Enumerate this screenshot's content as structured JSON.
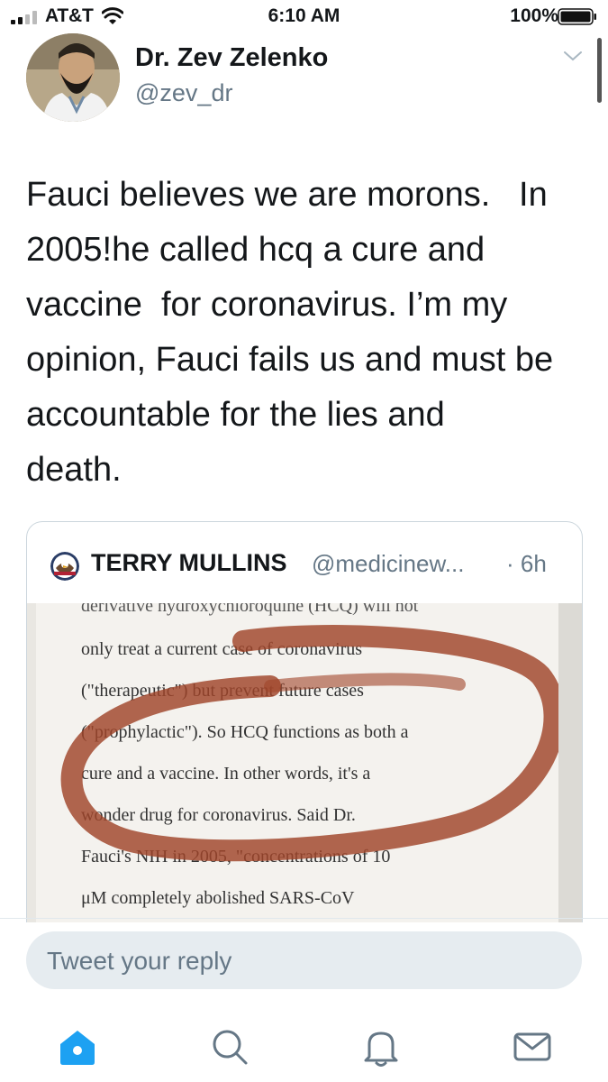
{
  "status_bar": {
    "carrier": "AT&T",
    "time": "6:10 AM",
    "battery": "100%"
  },
  "tweet": {
    "author_name": "Dr. Zev Zelenko",
    "author_handle": "@zev_dr",
    "text": "Fauci believes we are morons.   In\n2005!he called hcq a cure and\nvaccine  for coronavirus. I’m my\nopinion, Fauci fails us and must be\naccountable for the lies and\ndeath."
  },
  "quoted_tweet": {
    "author_name": "TERRY MULLINS",
    "author_handle": "@medicinew...",
    "time": "· 6h",
    "image_lines": [
      "derivative hydroxychloroquine (HCQ) will not",
      "only treat a current case of coronavirus",
      "(\"therapeutic\") but prevent future cases",
      "(\"prophylactic\"). So HCQ functions as both a",
      "cure and a vaccine. In other words, it's a",
      "wonder drug for coronavirus. Said Dr.",
      "Fauci's NIH in 2005, \"concentrations of 10",
      "μM completely abolished SARS-CoV"
    ]
  },
  "reply": {
    "placeholder": "Tweet your reply"
  },
  "tabs": {
    "home": "home-icon",
    "search": "search-icon",
    "notifications": "bell-icon",
    "messages": "mail-icon"
  },
  "colors": {
    "accent": "#1da1f2",
    "secondary_text": "#657786",
    "marker_circle": "#a0442a"
  }
}
